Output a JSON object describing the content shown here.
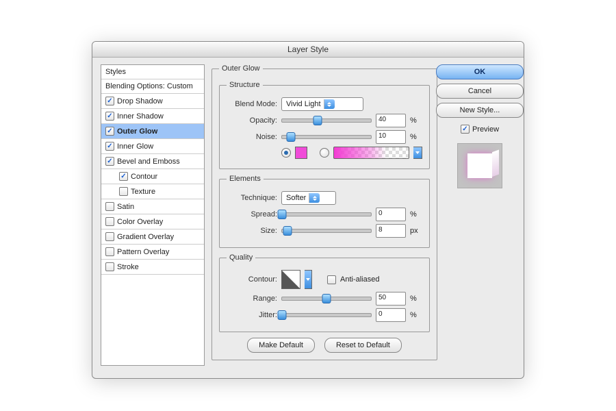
{
  "window": {
    "title": "Layer Style"
  },
  "sidebar": {
    "header": "Styles",
    "blending": "Blending Options: Custom",
    "items": [
      {
        "id": "drop-shadow",
        "label": "Drop Shadow",
        "checked": true
      },
      {
        "id": "inner-shadow",
        "label": "Inner Shadow",
        "checked": true
      },
      {
        "id": "outer-glow",
        "label": "Outer Glow",
        "checked": true,
        "selected": true
      },
      {
        "id": "inner-glow",
        "label": "Inner Glow",
        "checked": true
      },
      {
        "id": "bevel-emboss",
        "label": "Bevel and Emboss",
        "checked": true
      },
      {
        "id": "contour",
        "label": "Contour",
        "checked": true,
        "sub": true
      },
      {
        "id": "texture",
        "label": "Texture",
        "checked": false,
        "sub": true
      },
      {
        "id": "satin",
        "label": "Satin",
        "checked": false
      },
      {
        "id": "color-overlay",
        "label": "Color Overlay",
        "checked": false
      },
      {
        "id": "gradient-overlay",
        "label": "Gradient Overlay",
        "checked": false
      },
      {
        "id": "pattern-overlay",
        "label": "Pattern Overlay",
        "checked": false
      },
      {
        "id": "stroke",
        "label": "Stroke",
        "checked": false
      }
    ]
  },
  "panel": {
    "title": "Outer Glow",
    "structure": {
      "legend": "Structure",
      "blend_mode_label": "Blend Mode:",
      "blend_mode_value": "Vivid Light",
      "opacity_label": "Opacity:",
      "opacity_value": "40",
      "opacity_pct": 40,
      "noise_label": "Noise:",
      "noise_value": "10",
      "noise_pct": 10,
      "percent": "%",
      "color_radio_on": true,
      "gradient_radio_on": false,
      "swatch_hex": "#f04bd8"
    },
    "elements": {
      "legend": "Elements",
      "technique_label": "Technique:",
      "technique_value": "Softer",
      "spread_label": "Spread:",
      "spread_value": "0",
      "spread_pct": 0,
      "size_label": "Size:",
      "size_value": "8",
      "size_pct_of_track": 6,
      "px": "px",
      "percent": "%"
    },
    "quality": {
      "legend": "Quality",
      "contour_label": "Contour:",
      "aa_label": "Anti-aliased",
      "aa_checked": false,
      "range_label": "Range:",
      "range_value": "50",
      "range_pct": 50,
      "jitter_label": "Jitter:",
      "jitter_value": "0",
      "jitter_pct": 0,
      "percent": "%"
    },
    "buttons": {
      "make_default": "Make Default",
      "reset_default": "Reset to Default"
    }
  },
  "right": {
    "ok": "OK",
    "cancel": "Cancel",
    "new_style": "New Style...",
    "preview_label": "Preview",
    "preview_checked": true
  }
}
